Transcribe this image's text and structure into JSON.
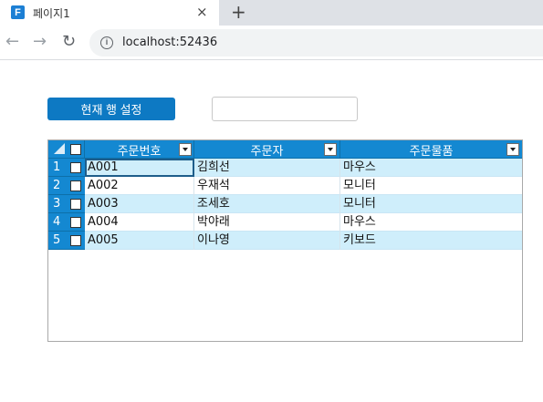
{
  "browser": {
    "tab_title": "페이지1",
    "favicon_letter": "F",
    "close_glyph": "×",
    "new_tab_glyph": "+",
    "back_glyph": "←",
    "forward_glyph": "→",
    "reload_glyph": "↻",
    "info_glyph": "i",
    "url": "localhost:52436"
  },
  "controls": {
    "set_row_button": "현재 행 설정",
    "row_input_value": ""
  },
  "grid": {
    "columns": [
      "주문번호",
      "주문자",
      "주문물품"
    ],
    "rows": [
      {
        "num": "1",
        "order_no": "A001",
        "customer": "김희선",
        "item": "마우스"
      },
      {
        "num": "2",
        "order_no": "A002",
        "customer": "우재석",
        "item": "모니터"
      },
      {
        "num": "3",
        "order_no": "A003",
        "customer": "조세호",
        "item": "모니터"
      },
      {
        "num": "4",
        "order_no": "A004",
        "customer": "박야래",
        "item": "마우스"
      },
      {
        "num": "5",
        "order_no": "A005",
        "customer": "이나영",
        "item": "키보드"
      }
    ]
  },
  "colors": {
    "header_bg": "#1488d1",
    "alt_row_bg": "#cfeefb",
    "button_bg": "#0d79c3"
  }
}
